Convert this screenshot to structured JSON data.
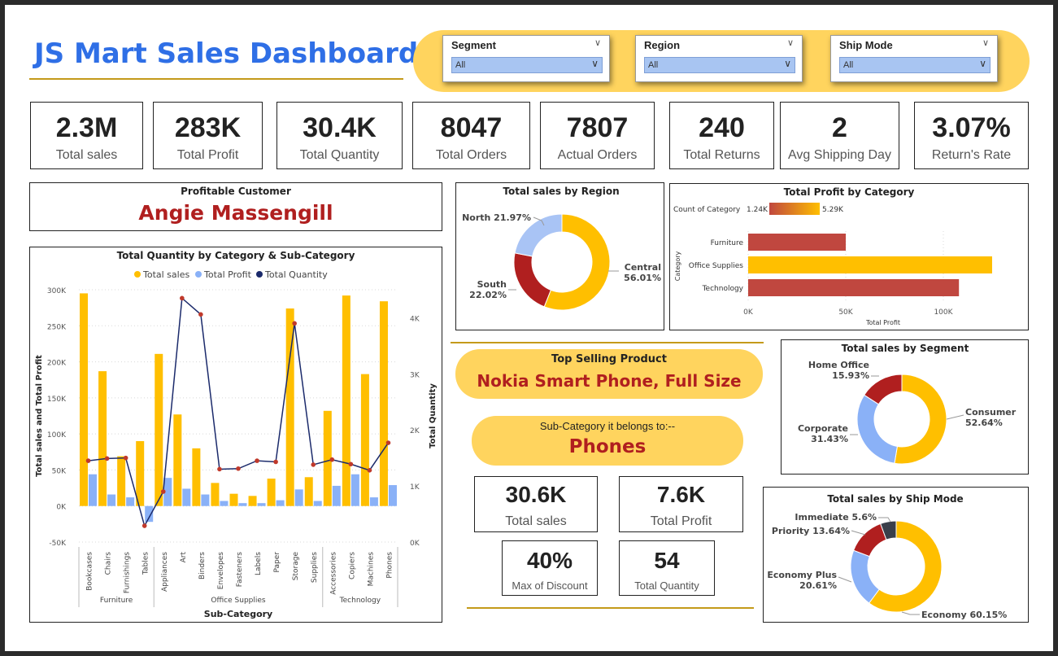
{
  "header": {
    "title": "JS Mart Sales Dashboard"
  },
  "colors": {
    "accent": "#2f6fe6",
    "gold": "#ffbf00",
    "pill": "#ffd45e",
    "red": "#b01f1f",
    "blue": "#8ab1f7",
    "navy": "#1b2a6b",
    "brick": "#c0473f",
    "dark": "#3a3f4a"
  },
  "slicers": [
    {
      "title": "Segment",
      "value": "All"
    },
    {
      "title": "Region",
      "value": "All"
    },
    {
      "title": "Ship Mode",
      "value": "All"
    }
  ],
  "kpis": [
    {
      "value": "2.3M",
      "label": "Total sales"
    },
    {
      "value": "283K",
      "label": "Total Profit"
    },
    {
      "value": "30.4K",
      "label": "Total Quantity"
    },
    {
      "value": "8047",
      "label": "Total Orders"
    },
    {
      "value": "7807",
      "label": "Actual Orders"
    },
    {
      "value": "240",
      "label": "Total Returns"
    },
    {
      "value": "2",
      "label": "Avg Shipping Day"
    },
    {
      "value": "3.07%",
      "label": "Return's Rate"
    }
  ],
  "profitable_customer": {
    "title": "Profitable Customer",
    "name": "Angie Massengill"
  },
  "top_product": {
    "title": "Top Selling Product",
    "name": "Nokia Smart Phone, Full Size"
  },
  "subcategory": {
    "title": "Sub-Category it belongs to:--",
    "name": "Phones"
  },
  "product_kpis": [
    {
      "value": "30.6K",
      "label": "Total sales"
    },
    {
      "value": "7.6K",
      "label": "Total Profit"
    },
    {
      "value": "40%",
      "label": "Max of Discount"
    },
    {
      "value": "54",
      "label": "Total Quantity"
    }
  ],
  "chart_data": [
    {
      "type": "bar",
      "title": "Total Quantity by Category & Sub-Category",
      "xlabel": "Sub-Category",
      "ylabel": "Total sales and Total Profit",
      "y2label": "Total Quantity",
      "ylim": [
        -50000,
        300000
      ],
      "yticks": [
        "300K",
        "250K",
        "200K",
        "150K",
        "100K",
        "50K",
        "0K",
        "-50K"
      ],
      "y2lim": [
        0,
        4500
      ],
      "y2ticks": [
        "4K",
        "3K",
        "2K",
        "1K",
        "0K"
      ],
      "legend": [
        "Total sales",
        "Total Profit",
        "Total Quantity"
      ],
      "groups": [
        {
          "name": "Furniture",
          "count": 4
        },
        {
          "name": "Office Supplies",
          "count": 9
        },
        {
          "name": "Technology",
          "count": 4
        }
      ],
      "categories": [
        "Bookcases",
        "Chairs",
        "Furnishings",
        "Tables",
        "Appliances",
        "Art",
        "Binders",
        "Envelopes",
        "Fasteners",
        "Labels",
        "Paper",
        "Storage",
        "Supplies",
        "Accessories",
        "Copiers",
        "Machines",
        "Phones"
      ],
      "series": [
        {
          "name": "Total sales",
          "type": "bar",
          "values": [
            295000,
            187000,
            69000,
            90000,
            211000,
            127000,
            80000,
            32000,
            17000,
            14000,
            38000,
            274000,
            40000,
            132000,
            292000,
            183000,
            284000
          ]
        },
        {
          "name": "Total Profit",
          "type": "bar",
          "values": [
            44000,
            16000,
            12000,
            -22000,
            39000,
            24000,
            16000,
            7000,
            4000,
            4000,
            8000,
            23000,
            7000,
            28000,
            44000,
            12000,
            29000
          ]
        },
        {
          "name": "Total Quantity",
          "type": "line",
          "values": [
            1450,
            1490,
            1500,
            290,
            900,
            4350,
            4060,
            1300,
            1310,
            1450,
            1430,
            3900,
            1380,
            1470,
            1390,
            1280,
            1770
          ]
        }
      ]
    },
    {
      "type": "pie",
      "title": "Total sales by Region",
      "slices": [
        {
          "name": "Central",
          "value": 56.01,
          "label": "Central 56.01%"
        },
        {
          "name": "South",
          "value": 22.02,
          "label": "South 22.02%"
        },
        {
          "name": "North",
          "value": 21.97,
          "label": "North 21.97%"
        }
      ]
    },
    {
      "type": "bar",
      "title": "Total Profit by Category",
      "orientation": "horizontal",
      "xlabel": "Total Profit",
      "ylabel": "Category",
      "xlim": [
        0,
        125000
      ],
      "xticks": [
        "0K",
        "50K",
        "100K"
      ],
      "color_legend": {
        "title": "Count of Category",
        "min": "1.24K",
        "max": "5.29K"
      },
      "categories": [
        "Furniture",
        "Office Supplies",
        "Technology"
      ],
      "values": [
        50000,
        125000,
        108000
      ]
    },
    {
      "type": "pie",
      "title": "Total sales by Segment",
      "slices": [
        {
          "name": "Consumer",
          "value": 52.64,
          "label": "Consumer 52.64%"
        },
        {
          "name": "Corporate",
          "value": 31.43,
          "label": "Corporate 31.43%"
        },
        {
          "name": "Home Office",
          "value": 15.93,
          "label": "Home Office 15.93%"
        }
      ]
    },
    {
      "type": "pie",
      "title": "Total sales by Ship Mode",
      "slices": [
        {
          "name": "Economy",
          "value": 60.15,
          "label": "Economy 60.15%"
        },
        {
          "name": "Economy Plus",
          "value": 20.61,
          "label": "Economy Plus 20.61%"
        },
        {
          "name": "Priority",
          "value": 13.64,
          "label": "Priority 13.64%"
        },
        {
          "name": "Immediate",
          "value": 5.6,
          "label": "Immediate 5.6%"
        }
      ]
    }
  ]
}
